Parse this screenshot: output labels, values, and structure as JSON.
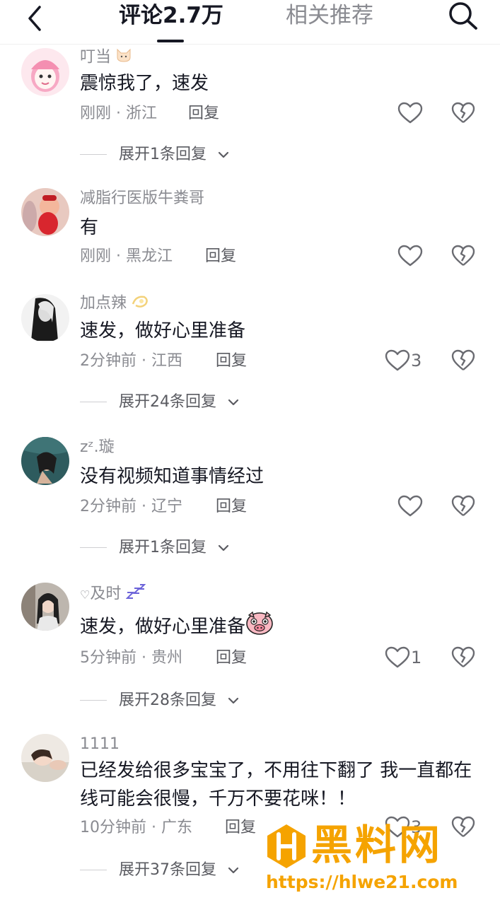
{
  "header": {
    "tab_comments": "评论2.7万",
    "tab_related": "相关推荐",
    "back_icon": "chevron-left-icon",
    "search_icon": "search-icon"
  },
  "reply_label": "回复",
  "comments": [
    {
      "username": "叮当",
      "username_emoji": "cat-face-emoji",
      "text": "震惊我了，速发",
      "time": "刚刚",
      "region": "浙江",
      "likes": "",
      "expand": "展开1条回复"
    },
    {
      "username": "减脂行医版牛粪哥",
      "text": "有",
      "time": "刚刚",
      "region": "黑龙江",
      "likes": "",
      "expand": ""
    },
    {
      "username": "加点辣",
      "username_emoji": "dizzy-emoji",
      "text": "速发，做好心里准备",
      "time": "2分钟前",
      "region": "江西",
      "likes": "3",
      "expand": "展开24条回复"
    },
    {
      "username": "zᶻ.璇",
      "text": "没有视频知道事情经过",
      "time": "2分钟前",
      "region": "辽宁",
      "likes": "",
      "expand": "展开1条回复"
    },
    {
      "username": "及时",
      "username_prefix": "♡",
      "username_emoji": "zzz-emoji",
      "text": "速发，做好心里准备",
      "text_emoji": "pig-face-emoji",
      "time": "5分钟前",
      "region": "贵州",
      "likes": "1",
      "expand": "展开28条回复"
    },
    {
      "username": "1111",
      "text": "已经发给很多宝宝了，不用往下翻了 我一直都在线可能会很慢，千万不要花咪！！",
      "time": "10分钟前",
      "region": "广东",
      "likes": "3",
      "expand": "展开37条回复"
    }
  ],
  "watermark": {
    "brand": "黑料网",
    "url": "https://hlwe21.com",
    "color": "#f5a300"
  }
}
